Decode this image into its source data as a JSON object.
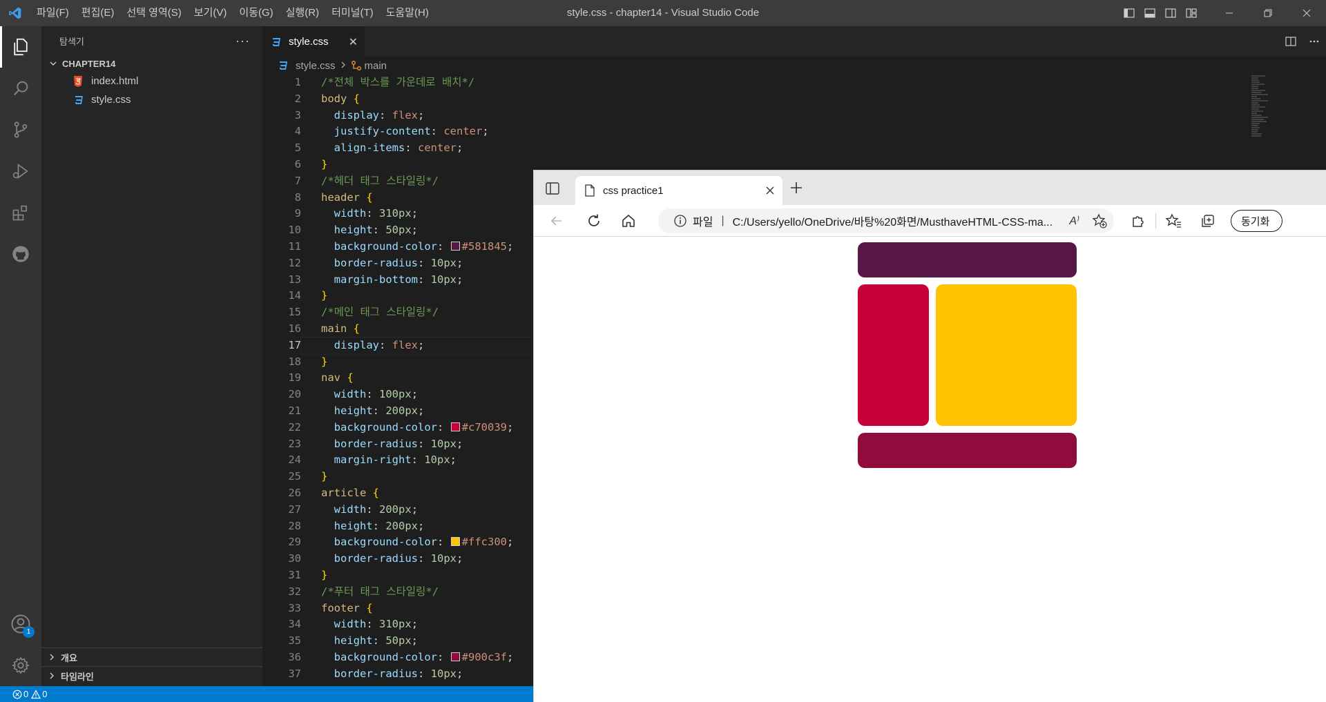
{
  "window": {
    "title": "style.css - chapter14 - Visual Studio Code",
    "menu": [
      "파일(F)",
      "편집(E)",
      "선택 영역(S)",
      "보기(V)",
      "이동(G)",
      "실행(R)",
      "터미널(T)",
      "도움말(H)"
    ]
  },
  "activity": {
    "accounts_badge": "1"
  },
  "explorer": {
    "title": "탐색기",
    "more": "···",
    "folder": "CHAPTER14",
    "files": [
      {
        "name": "index.html",
        "icon": "html5-icon",
        "color": "#e44d26"
      },
      {
        "name": "style.css",
        "icon": "css3-icon",
        "color": "#42a5f5"
      }
    ],
    "outline": "개요",
    "timeline": "타임라인"
  },
  "editor": {
    "tab_label": "style.css",
    "tab_close": "✕",
    "breadcrumb": {
      "file": "style.css",
      "symbol": "main"
    },
    "current_line": 17
  },
  "code": [
    {
      "n": "1",
      "parts": [
        [
          "com",
          "/*전체 박스를 가운데로 배치*/"
        ]
      ]
    },
    {
      "n": "2",
      "parts": [
        [
          "sel",
          "body "
        ],
        [
          "brace",
          "{"
        ]
      ]
    },
    {
      "n": "3",
      "parts": [
        [
          "sp",
          "  "
        ],
        [
          "prop",
          "display"
        ],
        [
          "punc",
          ": "
        ],
        [
          "val",
          "flex"
        ],
        [
          "punc",
          ";"
        ]
      ]
    },
    {
      "n": "4",
      "parts": [
        [
          "sp",
          "  "
        ],
        [
          "prop",
          "justify-content"
        ],
        [
          "punc",
          ": "
        ],
        [
          "val",
          "center"
        ],
        [
          "punc",
          ";"
        ]
      ]
    },
    {
      "n": "5",
      "parts": [
        [
          "sp",
          "  "
        ],
        [
          "prop",
          "align-items"
        ],
        [
          "punc",
          ": "
        ],
        [
          "val",
          "center"
        ],
        [
          "punc",
          ";"
        ]
      ]
    },
    {
      "n": "6",
      "parts": [
        [
          "brace",
          "}"
        ]
      ]
    },
    {
      "n": "7",
      "parts": [
        [
          "com",
          "/*헤더 태그 스타일링*/"
        ]
      ]
    },
    {
      "n": "8",
      "parts": [
        [
          "sel",
          "header "
        ],
        [
          "brace",
          "{"
        ]
      ]
    },
    {
      "n": "9",
      "parts": [
        [
          "sp",
          "  "
        ],
        [
          "prop",
          "width"
        ],
        [
          "punc",
          ": "
        ],
        [
          "num",
          "310px"
        ],
        [
          "punc",
          ";"
        ]
      ]
    },
    {
      "n": "10",
      "parts": [
        [
          "sp",
          "  "
        ],
        [
          "prop",
          "height"
        ],
        [
          "punc",
          ": "
        ],
        [
          "num",
          "50px"
        ],
        [
          "punc",
          ";"
        ]
      ]
    },
    {
      "n": "11",
      "parts": [
        [
          "sp",
          "  "
        ],
        [
          "prop",
          "background-color"
        ],
        [
          "punc",
          ": "
        ],
        [
          "swatch",
          "#581845"
        ],
        [
          "val",
          "#581845"
        ],
        [
          "punc",
          ";"
        ]
      ]
    },
    {
      "n": "12",
      "parts": [
        [
          "sp",
          "  "
        ],
        [
          "prop",
          "border-radius"
        ],
        [
          "punc",
          ": "
        ],
        [
          "num",
          "10px"
        ],
        [
          "punc",
          ";"
        ]
      ]
    },
    {
      "n": "13",
      "parts": [
        [
          "sp",
          "  "
        ],
        [
          "prop",
          "margin-bottom"
        ],
        [
          "punc",
          ": "
        ],
        [
          "num",
          "10px"
        ],
        [
          "punc",
          ";"
        ]
      ]
    },
    {
      "n": "14",
      "parts": [
        [
          "brace",
          "}"
        ]
      ]
    },
    {
      "n": "15",
      "parts": [
        [
          "com",
          "/*메인 태그 스타일링*/"
        ]
      ]
    },
    {
      "n": "16",
      "parts": [
        [
          "sel",
          "main "
        ],
        [
          "brace",
          "{"
        ]
      ]
    },
    {
      "n": "17",
      "parts": [
        [
          "sp",
          "  "
        ],
        [
          "prop",
          "display"
        ],
        [
          "punc",
          ": "
        ],
        [
          "val",
          "flex"
        ],
        [
          "punc",
          ";"
        ]
      ]
    },
    {
      "n": "18",
      "parts": [
        [
          "brace",
          "}"
        ]
      ]
    },
    {
      "n": "19",
      "parts": [
        [
          "sel",
          "nav "
        ],
        [
          "brace",
          "{"
        ]
      ]
    },
    {
      "n": "20",
      "parts": [
        [
          "sp",
          "  "
        ],
        [
          "prop",
          "width"
        ],
        [
          "punc",
          ": "
        ],
        [
          "num",
          "100px"
        ],
        [
          "punc",
          ";"
        ]
      ]
    },
    {
      "n": "21",
      "parts": [
        [
          "sp",
          "  "
        ],
        [
          "prop",
          "height"
        ],
        [
          "punc",
          ": "
        ],
        [
          "num",
          "200px"
        ],
        [
          "punc",
          ";"
        ]
      ]
    },
    {
      "n": "22",
      "parts": [
        [
          "sp",
          "  "
        ],
        [
          "prop",
          "background-color"
        ],
        [
          "punc",
          ": "
        ],
        [
          "swatch",
          "#c70039"
        ],
        [
          "val",
          "#c70039"
        ],
        [
          "punc",
          ";"
        ]
      ]
    },
    {
      "n": "23",
      "parts": [
        [
          "sp",
          "  "
        ],
        [
          "prop",
          "border-radius"
        ],
        [
          "punc",
          ": "
        ],
        [
          "num",
          "10px"
        ],
        [
          "punc",
          ";"
        ]
      ]
    },
    {
      "n": "24",
      "parts": [
        [
          "sp",
          "  "
        ],
        [
          "prop",
          "margin-right"
        ],
        [
          "punc",
          ": "
        ],
        [
          "num",
          "10px"
        ],
        [
          "punc",
          ";"
        ]
      ]
    },
    {
      "n": "25",
      "parts": [
        [
          "brace",
          "}"
        ]
      ]
    },
    {
      "n": "26",
      "parts": [
        [
          "sel",
          "article "
        ],
        [
          "brace",
          "{"
        ]
      ]
    },
    {
      "n": "27",
      "parts": [
        [
          "sp",
          "  "
        ],
        [
          "prop",
          "width"
        ],
        [
          "punc",
          ": "
        ],
        [
          "num",
          "200px"
        ],
        [
          "punc",
          ";"
        ]
      ]
    },
    {
      "n": "28",
      "parts": [
        [
          "sp",
          "  "
        ],
        [
          "prop",
          "height"
        ],
        [
          "punc",
          ": "
        ],
        [
          "num",
          "200px"
        ],
        [
          "punc",
          ";"
        ]
      ]
    },
    {
      "n": "29",
      "parts": [
        [
          "sp",
          "  "
        ],
        [
          "prop",
          "background-color"
        ],
        [
          "punc",
          ": "
        ],
        [
          "swatch",
          "#ffc300"
        ],
        [
          "val",
          "#ffc300"
        ],
        [
          "punc",
          ";"
        ]
      ]
    },
    {
      "n": "30",
      "parts": [
        [
          "sp",
          "  "
        ],
        [
          "prop",
          "border-radius"
        ],
        [
          "punc",
          ": "
        ],
        [
          "num",
          "10px"
        ],
        [
          "punc",
          ";"
        ]
      ]
    },
    {
      "n": "31",
      "parts": [
        [
          "brace",
          "}"
        ]
      ]
    },
    {
      "n": "32",
      "parts": [
        [
          "com",
          "/*푸터 태그 스타일링*/"
        ]
      ]
    },
    {
      "n": "33",
      "parts": [
        [
          "sel",
          "footer "
        ],
        [
          "brace",
          "{"
        ]
      ]
    },
    {
      "n": "34",
      "parts": [
        [
          "sp",
          "  "
        ],
        [
          "prop",
          "width"
        ],
        [
          "punc",
          ": "
        ],
        [
          "num",
          "310px"
        ],
        [
          "punc",
          ";"
        ]
      ]
    },
    {
      "n": "35",
      "parts": [
        [
          "sp",
          "  "
        ],
        [
          "prop",
          "height"
        ],
        [
          "punc",
          ": "
        ],
        [
          "num",
          "50px"
        ],
        [
          "punc",
          ";"
        ]
      ]
    },
    {
      "n": "36",
      "parts": [
        [
          "sp",
          "  "
        ],
        [
          "prop",
          "background-color"
        ],
        [
          "punc",
          ": "
        ],
        [
          "swatch",
          "#900c3f"
        ],
        [
          "val",
          "#900c3f"
        ],
        [
          "punc",
          ";"
        ]
      ]
    },
    {
      "n": "37",
      "parts": [
        [
          "sp",
          "  "
        ],
        [
          "prop",
          "border-radius"
        ],
        [
          "punc",
          ": "
        ],
        [
          "num",
          "10px"
        ],
        [
          "punc",
          ";"
        ]
      ]
    }
  ],
  "status": {
    "errors": "0",
    "warnings": "0"
  },
  "browser": {
    "tab_title": "css practice1",
    "address_label": "파일",
    "address_sep": "|",
    "url": "C:/Users/yello/OneDrive/바탕%20화면/MusthaveHTML-CSS-ma...",
    "read_aloud": "A⁾",
    "sync_label": "동기화",
    "page_colors": {
      "header": "#581845",
      "nav": "#c70039",
      "article": "#ffc300",
      "footer": "#900c3f"
    }
  }
}
